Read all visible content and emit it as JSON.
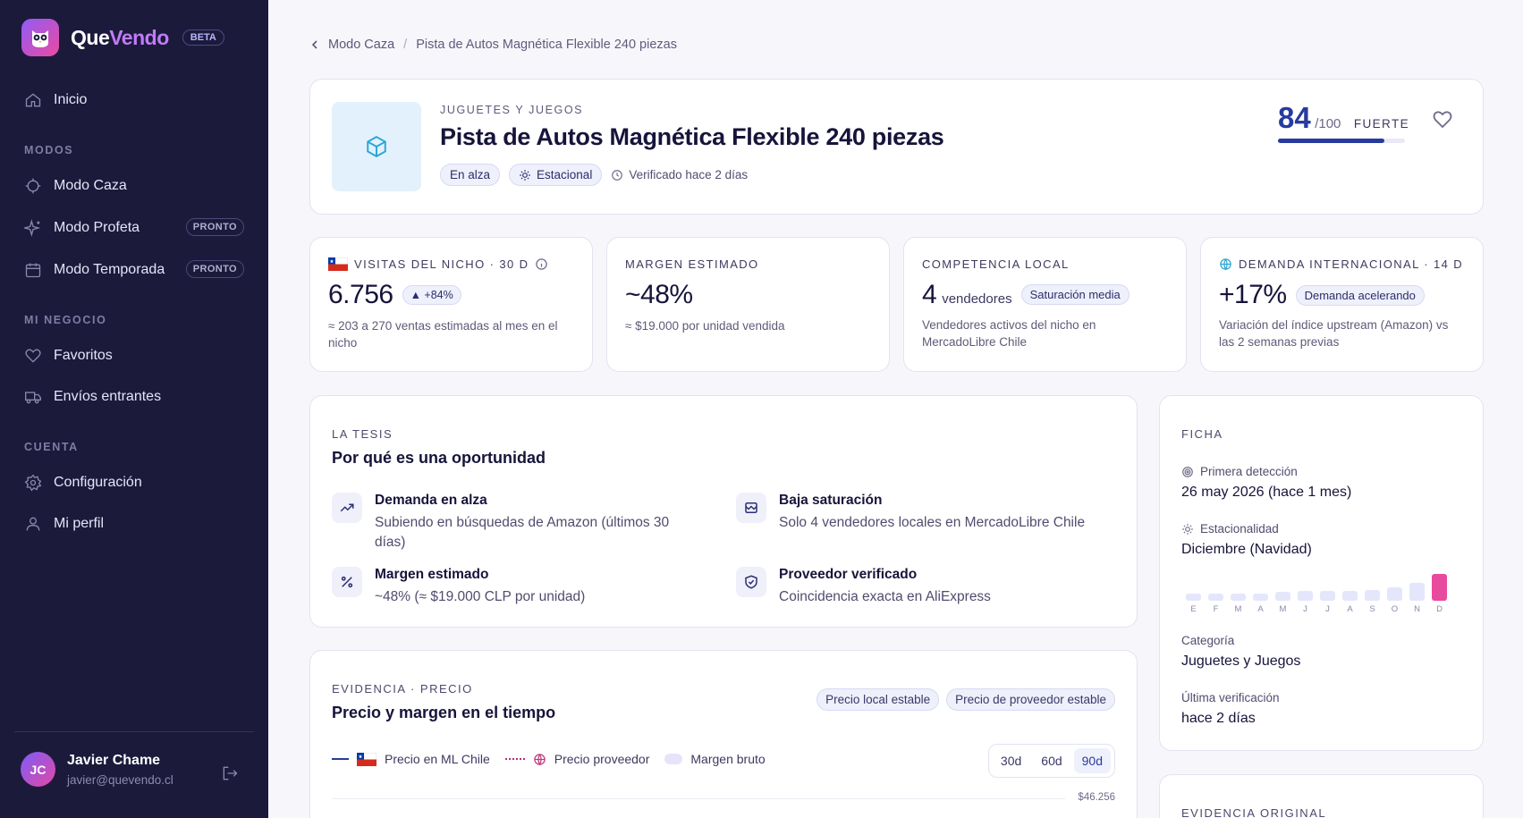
{
  "app": {
    "brand_a": "Que",
    "brand_b": "Vendo",
    "beta": "BETA"
  },
  "sidebar": {
    "inicio": "Inicio",
    "sec_modos": "MODOS",
    "modo_caza": "Modo Caza",
    "modo_profeta": "Modo Profeta",
    "modo_temporada": "Modo Temporada",
    "pronto": "PRONTO",
    "sec_negocio": "MI NEGOCIO",
    "favoritos": "Favoritos",
    "envios": "Envíos entrantes",
    "sec_cuenta": "CUENTA",
    "configuracion": "Configuración",
    "perfil": "Mi perfil",
    "user_initials": "JC",
    "user_name": "Javier Chame",
    "user_email": "javier@quevendo.cl"
  },
  "breadcrumb": {
    "parent": "Modo Caza",
    "sep": "/",
    "current": "Pista de Autos Magnética Flexible 240 piezas"
  },
  "product": {
    "category": "JUGUETES Y JUEGOS",
    "title": "Pista de Autos Magnética Flexible 240 piezas",
    "tag1": "En alza",
    "tag2": "Estacional",
    "verified": "Verificado hace 2 días",
    "score": "84",
    "score_den": "/100",
    "score_label": "FUERTE",
    "score_fraction": 0.84
  },
  "stats": {
    "visitas_label": "VISITAS DEL NICHO · 30 D",
    "visitas_value": "6.756",
    "visitas_delta": "▲ +84%",
    "visitas_sub": "≈ 203 a 270 ventas estimadas al mes en el nicho",
    "margen_label": "MARGEN ESTIMADO",
    "margen_value": "~48%",
    "margen_sub": "≈ $19.000 por unidad vendida",
    "comp_label": "COMPETENCIA LOCAL",
    "comp_value": "4",
    "comp_unit": "vendedores",
    "comp_tag": "Saturación media",
    "comp_sub": "Vendedores activos del nicho en MercadoLibre Chile",
    "dem_label": "DEMANDA INTERNACIONAL · 14 D",
    "dem_value": "+17%",
    "dem_tag": "Demanda acelerando",
    "dem_sub": "Variación del índice upstream (Amazon) vs las 2 semanas previas"
  },
  "tesis": {
    "kicker": "LA TESIS",
    "title": "Por qué es una oportunidad",
    "p1_h": "Demanda en alza",
    "p1_d": "Subiendo en búsquedas de Amazon (últimos 30 días)",
    "p2_h": "Baja saturación",
    "p2_d": "Solo 4 vendedores locales en MercadoLibre Chile",
    "p3_h": "Margen estimado",
    "p3_d": "~48% (≈ $19.000 CLP por unidad)",
    "p4_h": "Proveedor verificado",
    "p4_d": "Coincidencia exacta en AliExpress"
  },
  "evidencia": {
    "kicker": "EVIDENCIA · PRECIO",
    "title": "Precio y margen en el tiempo",
    "tag1": "Precio local estable",
    "tag2": "Precio de proveedor estable",
    "leg1": "Precio en ML Chile",
    "leg2": "Precio proveedor",
    "leg3": "Margen bruto",
    "tab1": "30d",
    "tab2": "60d",
    "tab3": "90d",
    "y_top": "$46.256"
  },
  "ficha": {
    "kicker": "FICHA",
    "k1": "Primera detección",
    "v1": "26 may 2026 (hace 1 mes)",
    "k2": "Estacionalidad",
    "v2": "Diciembre (Navidad)",
    "months": [
      "E",
      "F",
      "M",
      "A",
      "M",
      "J",
      "J",
      "A",
      "S",
      "O",
      "N",
      "D"
    ],
    "season_levels": [
      0.28,
      0.28,
      0.28,
      0.28,
      0.32,
      0.36,
      0.36,
      0.36,
      0.4,
      0.5,
      0.68,
      1.0
    ],
    "k3": "Categoría",
    "v3": "Juguetes y Juegos",
    "k4": "Última verificación",
    "v4": "hace 2 días",
    "evid_kicker": "EVIDENCIA ORIGINAL"
  },
  "colors": {
    "sidebar_bg": "#1c1a3b",
    "accent": "#273b9e",
    "pink": "#e84a9e"
  }
}
